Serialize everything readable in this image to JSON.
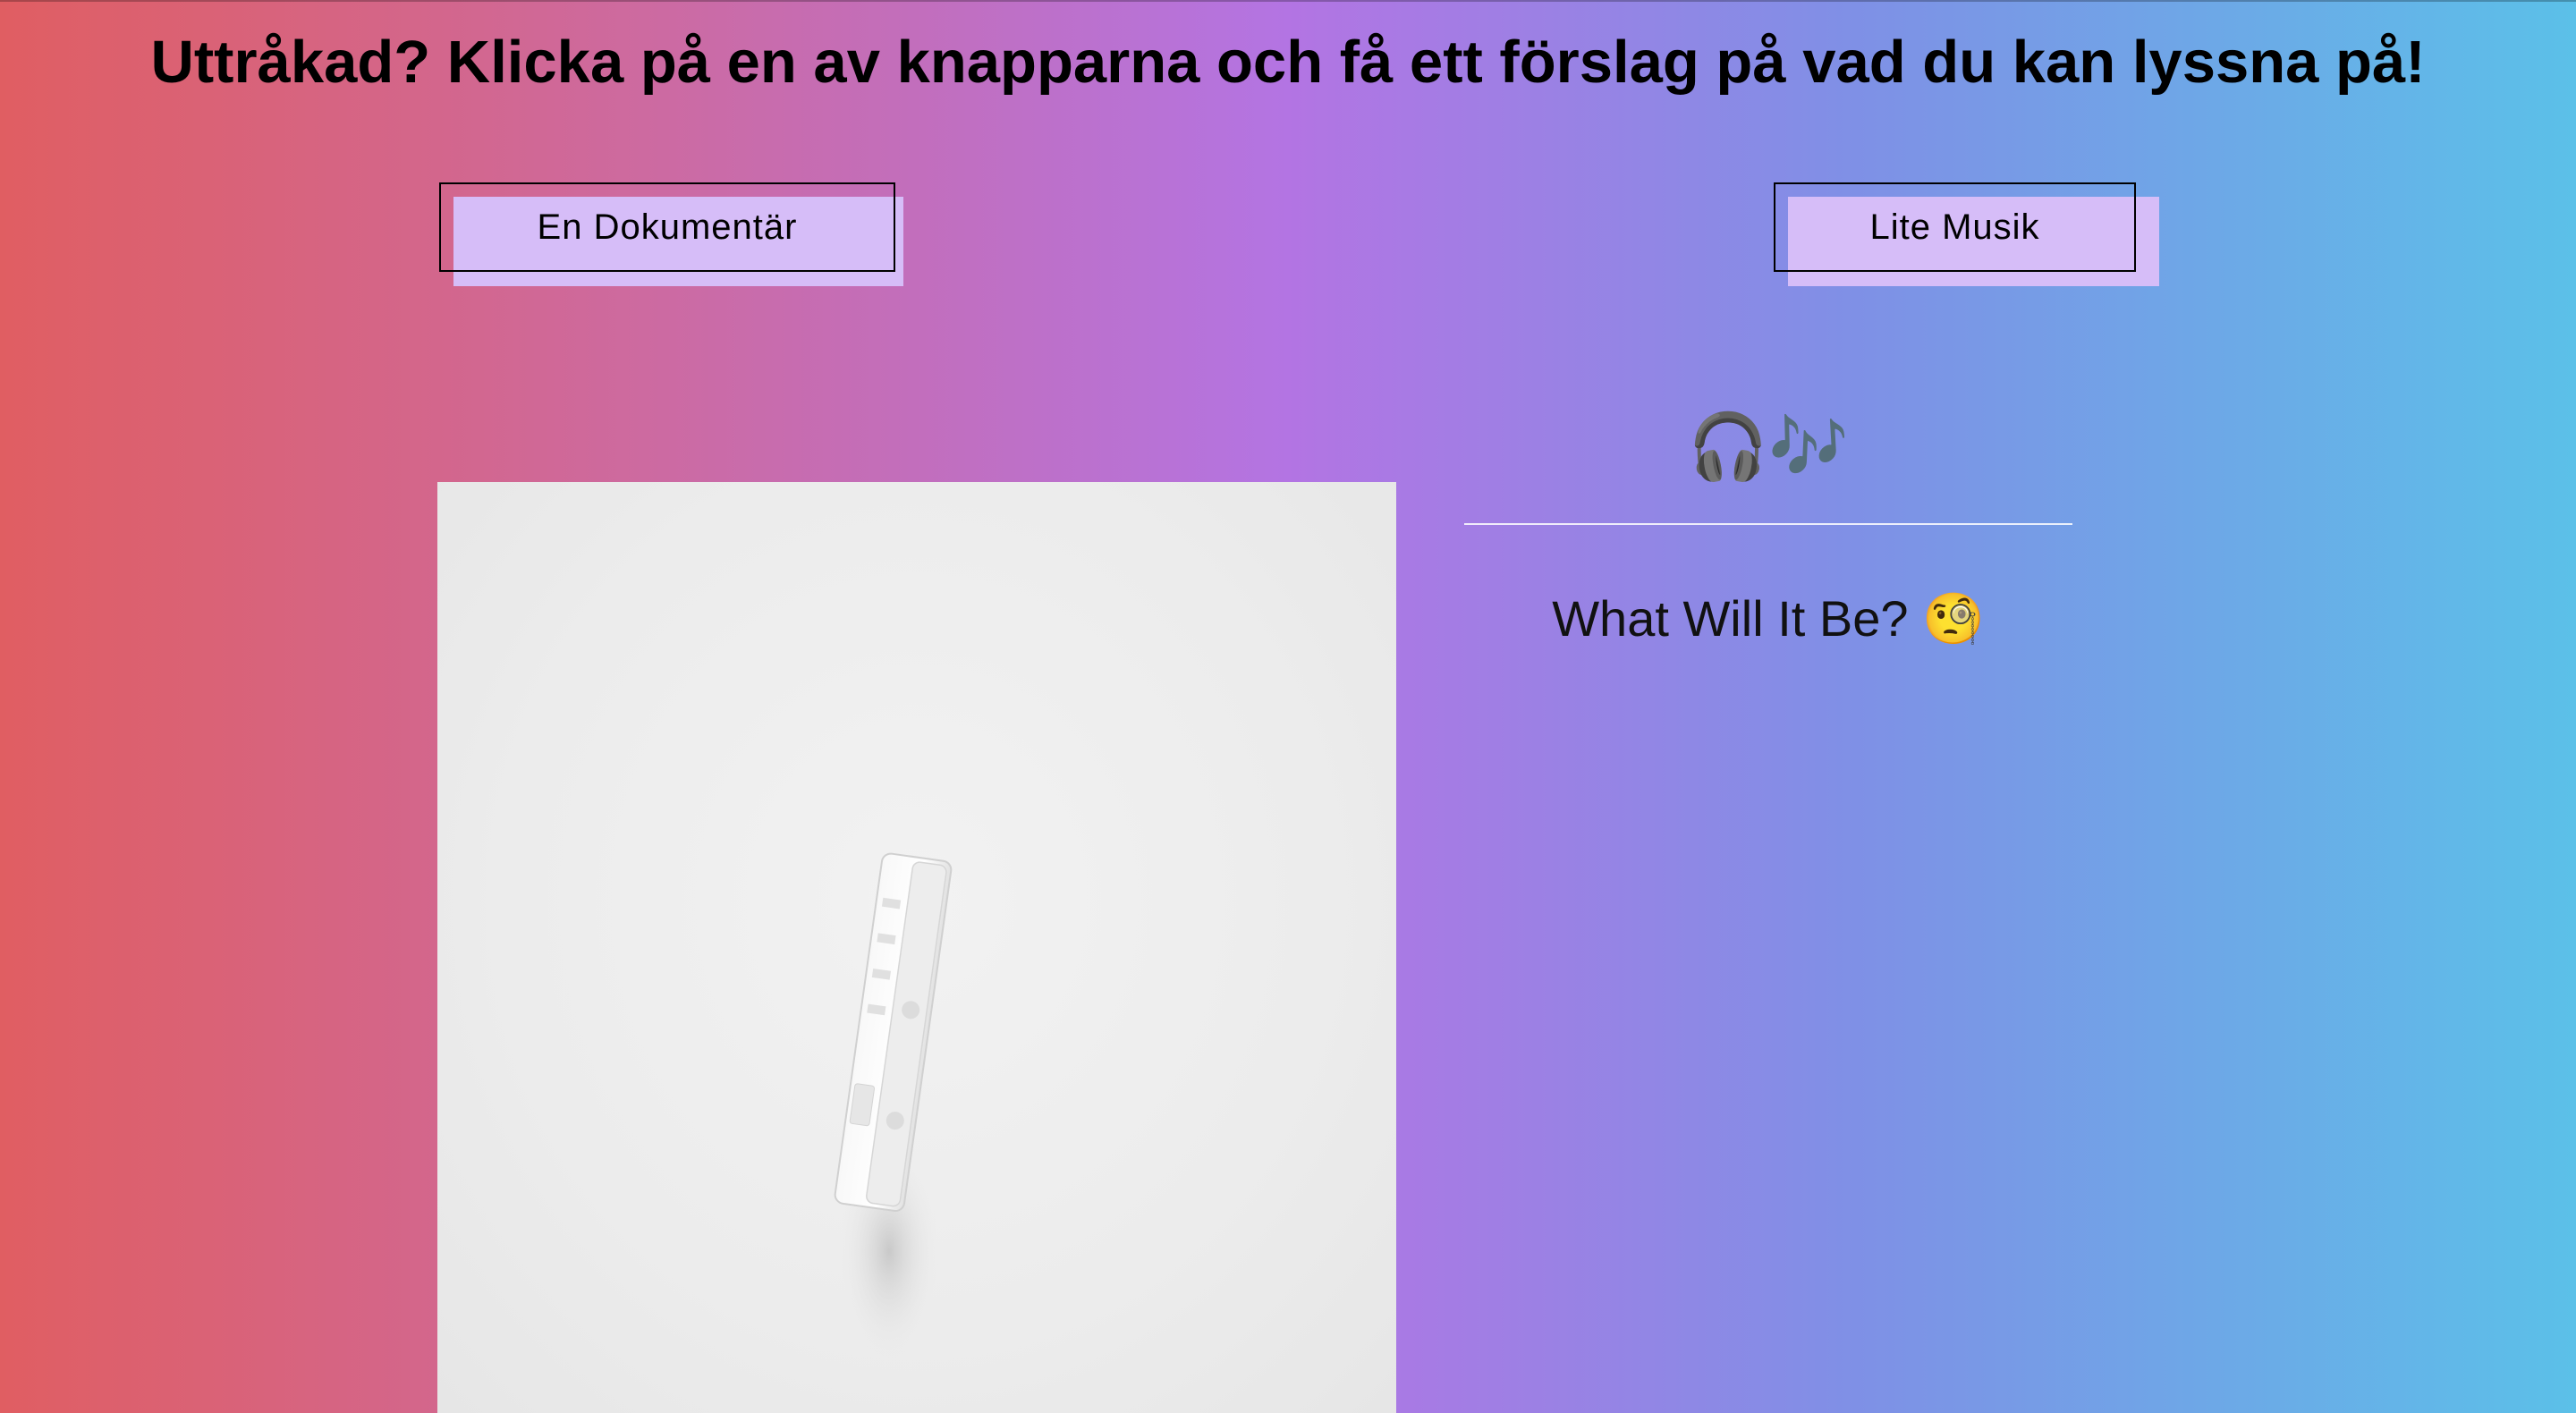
{
  "page": {
    "title": "Uttråkad? Klicka på en av knapparna och få ett förslag på vad du kan lyssna på!"
  },
  "buttons": {
    "documentary_label": "En Dokumentär",
    "music_label": "Lite Musik"
  },
  "result": {
    "icons_text": "🎧🎶",
    "suggestion_text": "What Will It Be? 🧐"
  },
  "image": {
    "subject": "white-cassette-tape"
  },
  "colors": {
    "gradient_left": "#e05e62",
    "gradient_mid": "#b374e3",
    "gradient_right": "#5bc0e8",
    "button_fill": "#d6bdf8",
    "divider": "#ffffff"
  }
}
